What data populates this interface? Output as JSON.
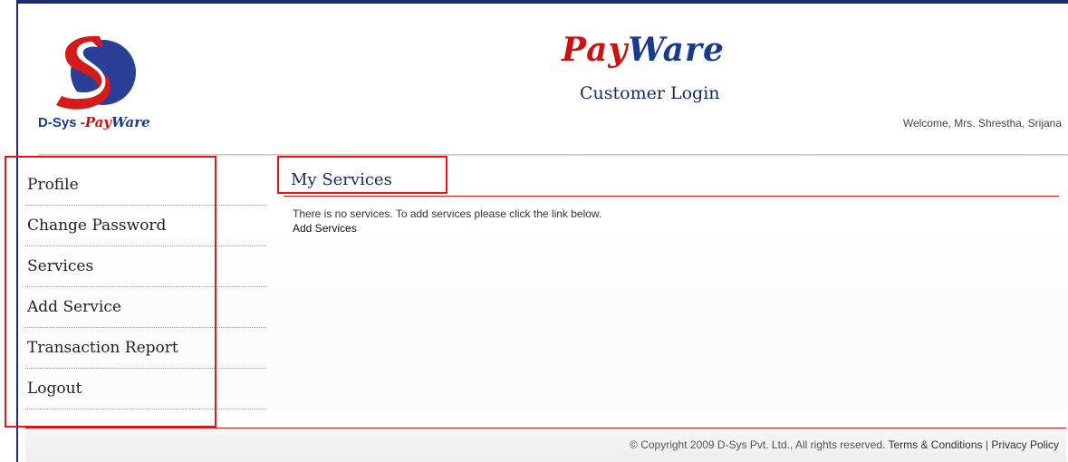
{
  "logo": {
    "text_dsys": "D-Sys",
    "text_dash": " -",
    "text_pay": "Pay",
    "text_ware": "Ware"
  },
  "header": {
    "brand_pay": "Pay",
    "brand_ware": "Ware",
    "subtitle": "Customer Login",
    "welcome": "Welcome, Mrs. Shrestha, Srijana"
  },
  "sidebar": {
    "items": [
      {
        "label": "Profile"
      },
      {
        "label": "Change Password"
      },
      {
        "label": "Services"
      },
      {
        "label": "Add Service"
      },
      {
        "label": "Transaction Report"
      },
      {
        "label": "Logout"
      }
    ]
  },
  "main": {
    "title": "My Services",
    "message": "There is no services. To add services please click the link below.",
    "add_link": "Add Services"
  },
  "footer": {
    "copyright": "© Copyright 2009 D-Sys Pvt. Ltd., All rights reserved.",
    "terms": "Terms & Conditions",
    "separator": "|",
    "privacy": "Privacy Policy"
  },
  "colors": {
    "frame": "#1f2a6b",
    "brand_red": "#cc1111",
    "brand_blue": "#1a3a8a",
    "highlight": "#ee1111"
  }
}
